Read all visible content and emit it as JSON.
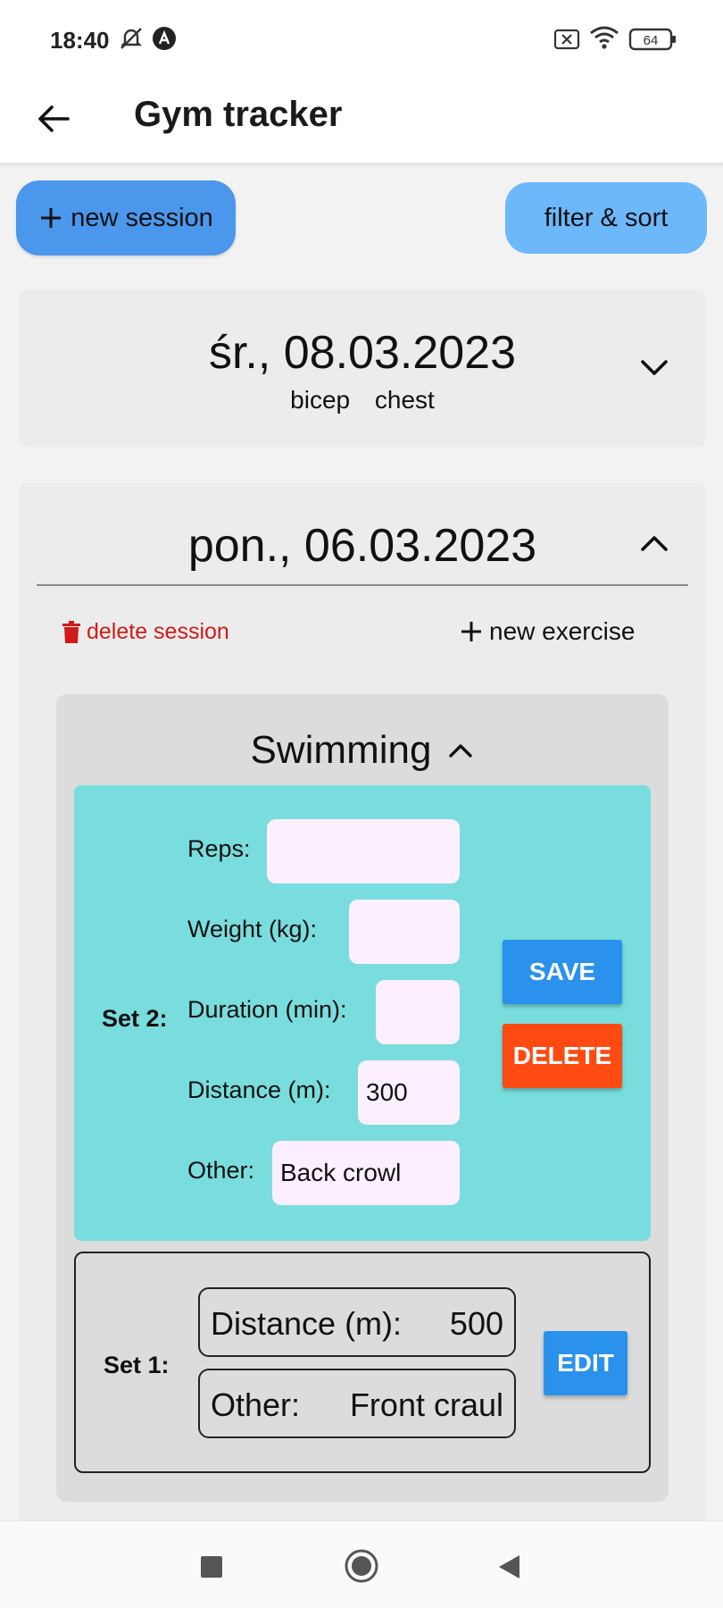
{
  "status_bar": {
    "time": "18:40",
    "battery": "64"
  },
  "app_bar": {
    "title": "Gym tracker"
  },
  "actions": {
    "new_session_label": "new session",
    "filter_sort_label": "filter & sort"
  },
  "sessions": [
    {
      "date": "śr., 08.03.2023",
      "tags": [
        "bicep",
        "chest"
      ],
      "expanded": false
    },
    {
      "date": "pon., 06.03.2023",
      "expanded": true,
      "delete_label": "delete session",
      "new_exercise_label": "new exercise",
      "exercise": {
        "name": "Swimming",
        "editing_set": {
          "label": "Set 2:",
          "fields": {
            "reps": {
              "label": "Reps:",
              "value": ""
            },
            "weight": {
              "label": "Weight  (kg):",
              "value": ""
            },
            "duration": {
              "label": "Duration (min):",
              "value": ""
            },
            "distance": {
              "label": "Distance (m):",
              "value": "300"
            },
            "other": {
              "label": "Other:",
              "value": "Back crowl"
            }
          },
          "save_label": "SAVE",
          "delete_label": "DELETE"
        },
        "saved_set": {
          "label": "Set 1:",
          "rows": [
            {
              "key": "Distance (m):",
              "value": "500"
            },
            {
              "key": "Other:",
              "value": "Front craul"
            }
          ],
          "edit_label": "EDIT"
        }
      }
    }
  ],
  "colors": {
    "primary_button": "#4a97ec",
    "secondary_button": "#6cb8fb",
    "editing_set_bg": "#79dddd",
    "save": "#2a92ec",
    "delete": "#ff4a12",
    "delete_text": "#d11a1a"
  }
}
